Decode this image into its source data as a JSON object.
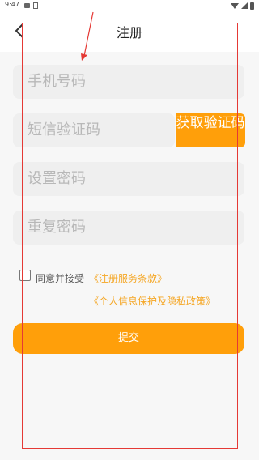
{
  "status_bar": {
    "time": "9:47"
  },
  "header": {
    "title": "注册"
  },
  "form": {
    "phone_placeholder": "手机号码",
    "sms_placeholder": "短信验证码",
    "get_code_label": "获取验证码",
    "password_placeholder": "设置密码",
    "repeat_password_placeholder": "重复密码"
  },
  "agreement": {
    "checked": false,
    "agree_text": "同意并接受",
    "terms_link": "《注册服务条款》",
    "privacy_link": "《个人信息保护及隐私政策》"
  },
  "submit": {
    "label": "提交"
  },
  "colors": {
    "accent": "#ff9f0a",
    "link": "#f5a623",
    "annotation": "#e53935",
    "field_bg": "#efefef"
  },
  "icons": {
    "back": "back-arrow-icon",
    "wifi": "wifi-icon",
    "signal": "signal-icon",
    "battery": "battery-icon"
  }
}
